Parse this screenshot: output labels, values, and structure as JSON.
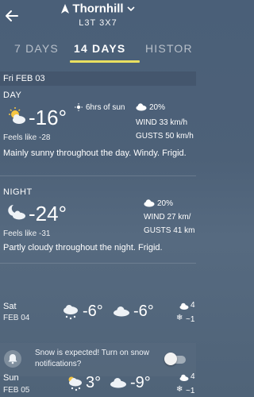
{
  "header": {
    "city": "Thornhill",
    "postal": "L3T 3X7"
  },
  "tabs": [
    {
      "label": "7 DAYS"
    },
    {
      "label": "14 DAYS"
    },
    {
      "label": "HISTOR"
    }
  ],
  "date_label": "Fri FEB 03",
  "day": {
    "label": "DAY",
    "temp": "-16°",
    "feels": "Feels like -28",
    "sun": "6hrs of sun",
    "precip": "20%",
    "wind": "WIND 33 km/h",
    "gusts": "GUSTS 50 km/h",
    "description": "Mainly sunny throughout the day. Windy. Frigid."
  },
  "night": {
    "label": "NIGHT",
    "temp": "-24°",
    "feels": "Feels like -31",
    "precip": "20%",
    "wind": "WIND 27 km/",
    "gusts": "GUSTS 41 km",
    "description": "Partly cloudy throughout the night. Frigid."
  },
  "rows": [
    {
      "day": "Sat",
      "date": "FEB 04",
      "high": "-6°",
      "low": "-6°",
      "precip": "4",
      "snow": "~1"
    },
    {
      "day": "Sun",
      "date": "FEB 05",
      "high": "3°",
      "low": "-9°",
      "precip": "4",
      "snow": "~1"
    }
  ],
  "notify": {
    "text": "Snow is expected! Turn on snow notifications?",
    "enabled": false
  }
}
